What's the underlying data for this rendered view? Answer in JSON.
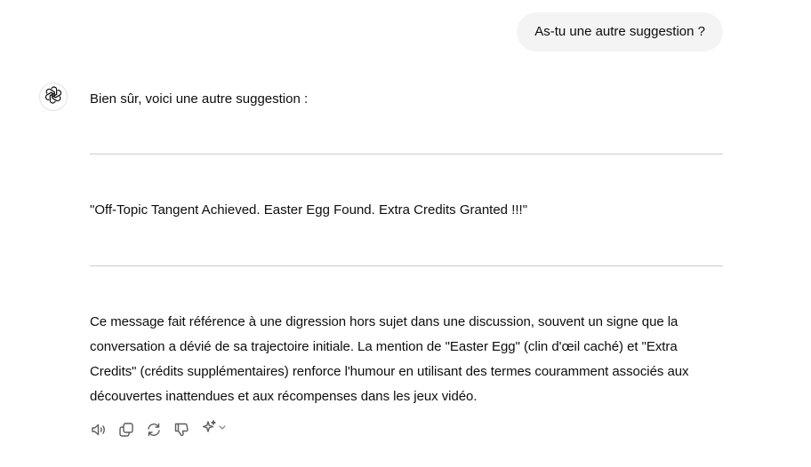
{
  "user_message": {
    "text": "As-tu une autre suggestion ?"
  },
  "assistant": {
    "avatar_icon": "openai-logo-icon",
    "intro": "Bien sûr, voici une autre suggestion :",
    "quote": "\"Off-Topic Tangent Achieved. Easter Egg Found. Extra Credits Granted !!!\"",
    "explanation": "Ce message fait référence à une digression hors sujet dans une discussion, souvent un signe que la conversation a dévié de sa trajectoire initiale. La mention de \"Easter Egg\" (clin d'œil caché) et \"Extra Credits\" (crédits supplémentaires) renforce l'humour en utilisant des termes couramment associés aux découvertes inattendues et aux récompenses dans les jeux vidéo."
  },
  "actions": [
    {
      "icon": "read-aloud-icon"
    },
    {
      "icon": "copy-icon"
    },
    {
      "icon": "regenerate-icon"
    },
    {
      "icon": "thumbs-down-icon"
    },
    {
      "icon": "sparkle-model-icon"
    }
  ],
  "colors": {
    "bubble_bg": "#f4f4f4",
    "text": "#0d0d0d",
    "divider": "#cdcdcd",
    "icon": "#5d5d5d"
  }
}
